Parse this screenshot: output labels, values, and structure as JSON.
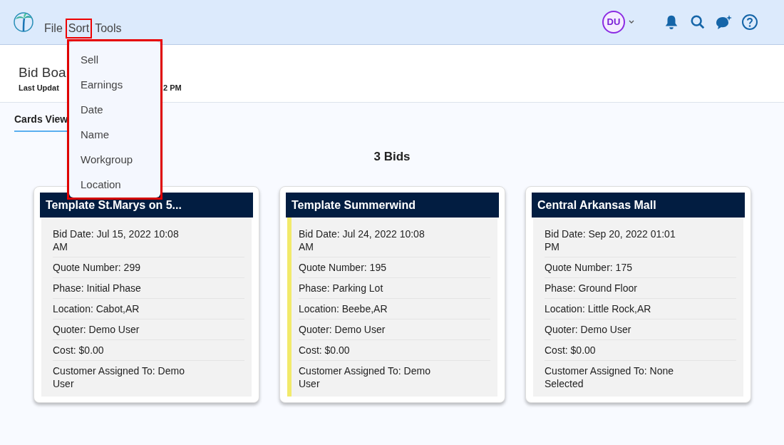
{
  "menu_bar": [
    {
      "label": "File",
      "highlighted": false
    },
    {
      "label": "Sort",
      "highlighted": true
    },
    {
      "label": "Tools",
      "highlighted": false
    }
  ],
  "user": {
    "initials": "DU"
  },
  "page": {
    "title": "Bid Boa",
    "last_updated_start": "Last Updat",
    "last_updated_end": "2 PM"
  },
  "tabs": [
    {
      "label": "Cards View",
      "selected": true
    }
  ],
  "sort_menu": {
    "highlighted": true,
    "items": [
      "Sell",
      "Earnings",
      "Date",
      "Name",
      "Workgroup",
      "Location"
    ]
  },
  "count": "3 Bids",
  "cards": [
    {
      "title": "Template St.Marys on 5...",
      "flagged": false,
      "fields": [
        "Bid Date: Jul 15, 2022 10:08 AM",
        "Quote Number: 299",
        "Phase: Initial Phase",
        "Location: Cabot,AR",
        "Quoter: Demo User",
        "Cost: $0.00",
        "Customer Assigned To: Demo User"
      ]
    },
    {
      "title": "Template Summerwind",
      "flagged": true,
      "fields": [
        "Bid Date: Jul 24, 2022 10:08 AM",
        "Quote Number: 195",
        "Phase: Parking Lot",
        "Location: Beebe,AR",
        "Quoter: Demo User",
        "Cost: $0.00",
        "Customer Assigned To: Demo User"
      ]
    },
    {
      "title": "Central Arkansas Mall",
      "flagged": false,
      "fields": [
        "Bid Date: Sep 20, 2022 01:01 PM",
        "Quote Number: 175",
        "Phase: Ground Floor",
        "Location: Little Rock,AR",
        "Quoter: Demo User",
        "Cost: $0.00",
        "Customer Assigned To: None Selected"
      ]
    }
  ]
}
